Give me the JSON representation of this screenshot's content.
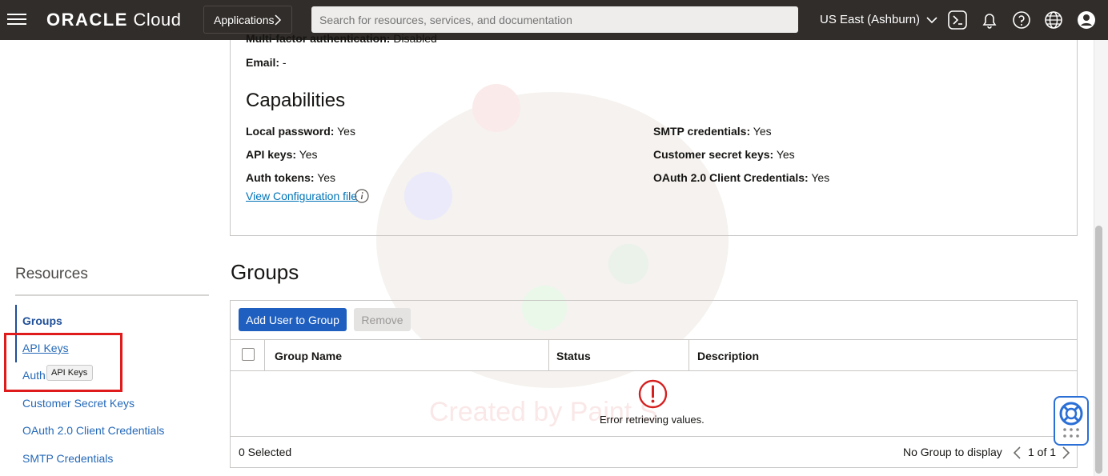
{
  "header": {
    "brand_bold": "ORACLE",
    "brand_light": "Cloud",
    "applications_label": "Applications",
    "search_placeholder": "Search for resources, services, and documentation",
    "region": "US East (Ashburn)"
  },
  "details": {
    "mfa_label": "Multi-factor authentication:",
    "mfa_value": "Disabled",
    "email_label": "Email:",
    "email_value": "-"
  },
  "capabilities": {
    "title": "Capabilities",
    "left": [
      {
        "label": "Local password:",
        "value": "Yes"
      },
      {
        "label": "API keys:",
        "value": "Yes"
      },
      {
        "label": "Auth tokens:",
        "value": "Yes"
      }
    ],
    "right": [
      {
        "label": "SMTP credentials:",
        "value": "Yes"
      },
      {
        "label": "Customer secret keys:",
        "value": "Yes"
      },
      {
        "label": "OAuth 2.0 Client Credentials:",
        "value": "Yes"
      }
    ],
    "view_config": "View Configuration file"
  },
  "resources": {
    "title": "Resources",
    "items": [
      {
        "label": "Groups"
      },
      {
        "label": "API Keys"
      },
      {
        "label": "Auth"
      },
      {
        "label": "Customer Secret Keys"
      },
      {
        "label": "OAuth 2.0 Client Credentials"
      },
      {
        "label": "SMTP Credentials"
      }
    ],
    "tooltip": "API Keys"
  },
  "groups": {
    "title": "Groups",
    "add_button": "Add User to Group",
    "remove_button": "Remove",
    "columns": [
      "Group Name",
      "Status",
      "Description"
    ],
    "error_text": "Error retrieving values.",
    "selected_text": "0 Selected",
    "no_group_text": "No Group to display",
    "pager_text": "1 of 1"
  },
  "watermark": "Created by Paint S"
}
